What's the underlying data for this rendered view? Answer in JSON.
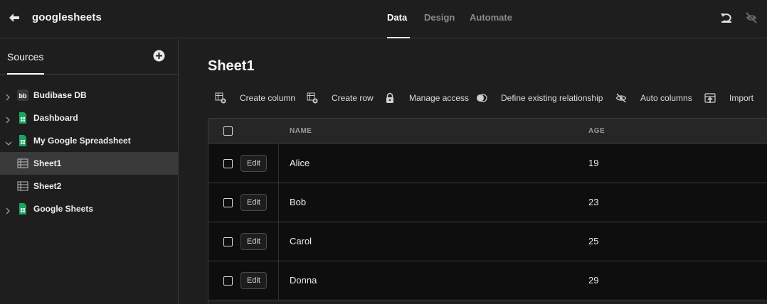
{
  "header": {
    "app_title": "googlesheets",
    "tabs": [
      {
        "label": "Data",
        "active": true
      },
      {
        "label": "Design",
        "active": false
      },
      {
        "label": "Automate",
        "active": false
      }
    ]
  },
  "sidebar": {
    "title": "Sources",
    "items": [
      {
        "label": "Budibase DB",
        "icon": "budibase-icon",
        "expanded": false
      },
      {
        "label": "Dashboard",
        "icon": "google-sheets-icon",
        "expanded": false
      },
      {
        "label": "My Google Spreadsheet",
        "icon": "google-sheets-icon",
        "expanded": true
      },
      {
        "label": "Sheet1",
        "icon": "table-icon",
        "selected": true
      },
      {
        "label": "Sheet2",
        "icon": "table-icon",
        "selected": false
      },
      {
        "label": "Google Sheets",
        "icon": "google-sheets-icon",
        "expanded": false
      }
    ]
  },
  "main": {
    "title": "Sheet1",
    "actions": [
      {
        "label": "Create column",
        "icon": "create-column-icon"
      },
      {
        "label": "Create row",
        "icon": "create-row-icon"
      },
      {
        "label": "Manage access",
        "icon": "lock-icon"
      },
      {
        "label": "Define existing relationship",
        "icon": "relationship-icon"
      },
      {
        "label": "Auto columns",
        "icon": "eye-off-icon"
      },
      {
        "label": "Import",
        "icon": "import-icon"
      }
    ],
    "table": {
      "columns": [
        "NAME",
        "AGE"
      ],
      "edit_label": "Edit",
      "rows": [
        {
          "name": "Alice",
          "age": "19"
        },
        {
          "name": "Bob",
          "age": "23"
        },
        {
          "name": "Carol",
          "age": "25"
        },
        {
          "name": "Donna",
          "age": "29"
        }
      ]
    }
  },
  "colors": {
    "background": "#1e1e1e",
    "table_row_bg": "#0e0e0e",
    "sheets_green": "#1ea362",
    "border": "#3a3a3a"
  }
}
